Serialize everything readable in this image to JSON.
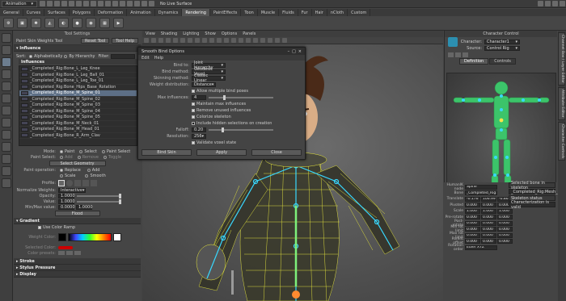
{
  "menubar": {
    "mode_dropdown": "Animation",
    "live_surface": "No Live Surface"
  },
  "shelf_tabs": [
    "General",
    "Curves",
    "Surfaces",
    "Polygons",
    "Deformation",
    "Animation",
    "Dynamics",
    "Rendering",
    "PaintEffects",
    "Toon",
    "Muscle",
    "Fluids",
    "Fur",
    "Hair",
    "nCloth",
    "Custom"
  ],
  "shelf_active_tab": "Rendering",
  "tool_settings": {
    "title": "Tool Settings",
    "tool_name": "Paint Skin Weights Tool",
    "reset_button": "Reset Tool",
    "help_button": "Tool Help",
    "section_influence": "Influence",
    "sort_label": "Sort:",
    "sort_alpha": "Alphabetically",
    "sort_hier": "By Hierarchy",
    "filter_label": "Filter:",
    "list_header": "Influences",
    "influences": [
      "_Completed_Rig:Bone_L_Leg_Knee",
      "_Completed_Rig:Bone_L_Leg_Ball_01",
      "_Completed_Rig:Bone_L_Leg_Toe_01",
      "_Completed_Rig:Bone_Hips_Base_Rotation",
      "_Completed_Rig:Bone_M_Spine_01",
      "_Completed_Rig:Bone_M_Spine_02",
      "_Completed_Rig:Bone_M_Spine_03",
      "_Completed_Rig:Bone_M_Spine_04",
      "_Completed_Rig:Bone_M_Spine_05",
      "_Completed_Rig:Bone_M_Neck_01",
      "_Completed_Rig:Bone_M_Head_01",
      "_Completed_Rig:Bone_R_Arm_Clav"
    ],
    "selected_influence_index": 4,
    "mode_label": "Mode:",
    "mode_paint": "Paint",
    "mode_select": "Select",
    "mode_paint_select": "Paint Select",
    "paint_select_label": "Paint Select:",
    "ps_add": "Add",
    "ps_remove": "Remove",
    "ps_toggle": "Toggle",
    "select_geometry": "Select Geometry",
    "paint_op_label": "Paint operation:",
    "op_replace": "Replace",
    "op_add": "Add",
    "op_scale": "Scale",
    "op_smooth": "Smooth",
    "profile_label": "Profile:",
    "normalize_label": "Normalize Weights:",
    "normalize_value": "Interactive",
    "opacity_label": "Opacity:",
    "opacity_value": "1.0000",
    "value_label": "Value:",
    "value_value": "1.0000",
    "minmax_label": "Min/Max value:",
    "min_value": "0.0000",
    "max_value": "1.0000",
    "flood_button": "Flood",
    "section_gradient": "Gradient",
    "use_color_ramp": "Use Color Ramp",
    "weight_color_label": "Weight Color:",
    "selected_color_label": "Selected Color:",
    "color_presets_label": "Color presets:",
    "section_stroke": "Stroke",
    "section_stylus": "Stylus Pressure",
    "section_display": "Display"
  },
  "viewport": {
    "menu": [
      "View",
      "Shading",
      "Lighting",
      "Show",
      "Options",
      "Panels"
    ]
  },
  "dialog": {
    "title": "Smooth Bind Options",
    "menu": [
      "Edit",
      "Help"
    ],
    "bind_to_label": "Bind to:",
    "bind_to_value": "Joint hierarchy",
    "bind_method_label": "Bind method:",
    "bind_method_value": "Geodesic Voxel",
    "skinning_label": "Skinning method:",
    "skinning_value": "Classic Linear",
    "weight_dist_label": "Weight distribution:",
    "weight_dist_value": "Distance",
    "allow_multiple": "Allow multiple bind poses",
    "max_influences_label": "Max influences:",
    "max_influences_value": "4",
    "maintain_max": "Maintain max influences",
    "remove_unused": "Remove unused influences",
    "colorize": "Colorize skeleton",
    "include_hidden": "Include hidden selections on creation",
    "falloff_label": "Falloff:",
    "falloff_value": "0.20",
    "resolution_label": "Resolution:",
    "resolution_value": "256",
    "validate": "Validate voxel state",
    "btn_bind": "Bind Skin",
    "btn_apply": "Apply",
    "btn_close": "Close"
  },
  "character_control": {
    "title": "Character Control",
    "character_label": "Character:",
    "character_value": "Character1",
    "source_label": "Source:",
    "source_value": "Control Rig",
    "tab_definition": "Definition",
    "tab_controls": "Controls"
  },
  "channel_box": {
    "object_name_label": "HumanIK node",
    "object_name_value": "Spine",
    "rows": [
      {
        "label": "Bone",
        "v": [
          "_Completed_Rig:Bone_M_Spine_01"
        ]
      },
      {
        "label": "Translate",
        "v": [
          "-0.176",
          "106.999",
          "-0.863"
        ]
      },
      {
        "label": "Pivoted",
        "v": [
          "0.000",
          "0.000",
          "0.000"
        ]
      },
      {
        "label": "Scale",
        "v": [
          "1.000",
          "1.000",
          "1.000"
        ]
      },
      {
        "label": "Pre-rotate",
        "v": [
          "0.000",
          "0.000",
          "0.000"
        ]
      },
      {
        "label": "Post-rotate",
        "v": [
          "0.000",
          "0.000",
          "0.000"
        ]
      },
      {
        "label": "Min rot limit",
        "v": [
          "0.000",
          "0.000",
          "0.000"
        ]
      },
      {
        "label": "Max rot limit",
        "v": [
          "0.000",
          "0.000",
          "0.000"
        ]
      },
      {
        "label": "Parent offset",
        "v": [
          "0.000",
          "0.000",
          "0.000"
        ]
      },
      {
        "label": "Rotation order",
        "v": [
          "Euler XYZ"
        ]
      }
    ],
    "side_header": "Selected bone in skeleton",
    "side_value": "_Completed_Rig:Mesh_M_Body",
    "side_status_label": "Skeleton status",
    "side_status": "Characterization is valid"
  },
  "vertical_tabs": [
    "Channel Box / Layer Editor",
    "Attribute Editor",
    "Character Controls"
  ],
  "colors": {
    "accent_blue": "#5d6f86",
    "bone_green": "#7ef07a",
    "skeleton_cyan": "#38d8ff",
    "wire_yellow": "#e8e83a"
  }
}
